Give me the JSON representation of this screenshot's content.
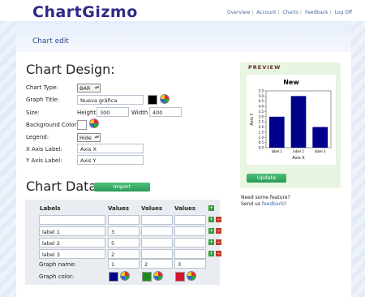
{
  "brand": {
    "logo": "ChartGizmo"
  },
  "nav": {
    "items": [
      "Overview",
      "Account",
      "Charts",
      "Feedback",
      "Log Off"
    ]
  },
  "page": {
    "title": "Chart edit"
  },
  "design": {
    "heading": "Chart Design:",
    "chart_type_label": "Chart Type:",
    "chart_type_value": "BAR",
    "graph_title_label": "Graph Title:",
    "graph_title_value": "Nueva gráfica",
    "size_label": "Size:",
    "height_label": "Height",
    "height_value": "300",
    "width_label": "Width",
    "width_value": "400",
    "bg_label": "Background Color:",
    "legend_label": "Legend:",
    "legend_value": "Hide",
    "x_label": "X Axis Label:",
    "x_value": "Axis X",
    "y_label": "Y Axis Label:",
    "y_value": "Axis Y"
  },
  "data": {
    "heading": "Chart Data:",
    "import_label": "Import",
    "headers": [
      "Labels",
      "Values",
      "Values",
      "Values"
    ],
    "rows": [
      {
        "label": "label 1",
        "v1": "3",
        "v2": "",
        "v3": ""
      },
      {
        "label": "label 2",
        "v1": "5",
        "v2": "",
        "v3": ""
      },
      {
        "label": "label 3",
        "v1": "2",
        "v2": "",
        "v3": ""
      }
    ],
    "graph_name_label": "Graph name:",
    "graph_names": [
      "1",
      "2",
      "3"
    ],
    "graph_color_label": "Graph color:",
    "graph_colors": [
      "#00008b",
      "#1e8a1e",
      "#d4142a"
    ]
  },
  "preview": {
    "heading": "PREVIEW",
    "update_label": "Update"
  },
  "feedback": {
    "line1": "Need some feature?",
    "line2_prefix": "Send us ",
    "link": "feedback",
    "line2_suffix": "!"
  },
  "chart_data": {
    "type": "bar",
    "title": "New",
    "categories": [
      "label 1",
      "label 2",
      "label 3"
    ],
    "values": [
      3,
      5,
      2
    ],
    "xlabel": "Axis X",
    "ylabel": "Axis Y",
    "ylim": [
      0,
      5.5
    ],
    "yticks": [
      "0.0",
      "0.5",
      "1.0",
      "1.5",
      "2.0",
      "2.5",
      "3.0",
      "3.5",
      "4.0",
      "4.5",
      "5.0",
      "5.5"
    ],
    "bar_color": "#00008b",
    "legend": false
  }
}
